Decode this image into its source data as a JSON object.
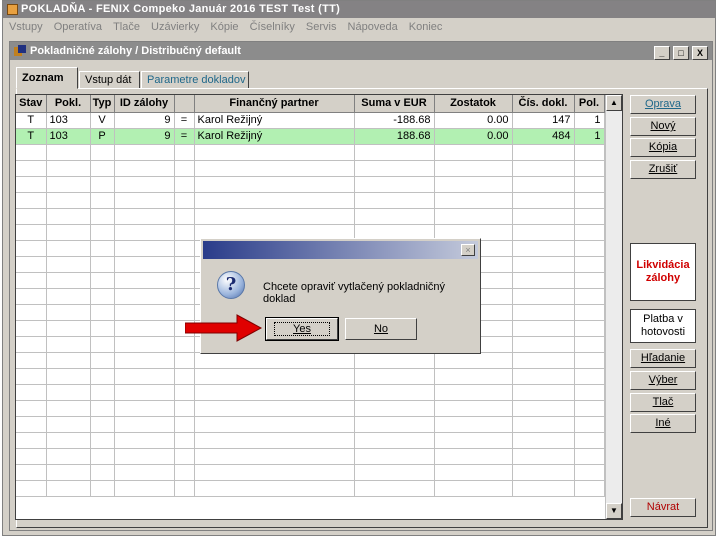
{
  "app": {
    "title": "POKLADŇA - FENIX Compeko  Január 2016  TEST Test  (TT)"
  },
  "menu": [
    "Vstupy",
    "Operatíva",
    "Tlače",
    "Uzávierky",
    "Kópie",
    "Číselníky",
    "Servis",
    "Nápoveda",
    "Koniec"
  ],
  "window": {
    "title": "Pokladničné zálohy / Distribučný default",
    "minimize": "_",
    "maximize": "□",
    "close": "X"
  },
  "tabs": [
    "Zoznam",
    "Vstup dát",
    "Parametre dokladov"
  ],
  "table": {
    "columns": [
      "Stav",
      "Pokl.",
      "Typ",
      "ID zálohy",
      "",
      "Finančný partner",
      "Suma v EUR",
      "Zostatok",
      "Čís. dokl.",
      "Pol."
    ],
    "rows": [
      [
        "T",
        "103",
        "V",
        "9",
        "=",
        "Karol Režijný",
        "-188.68",
        "0.00",
        "147",
        "1"
      ],
      [
        "T",
        "103",
        "P",
        "9",
        "=",
        "Karol Režijný",
        "188.68",
        "0.00",
        "484",
        "1"
      ]
    ],
    "selected_row": 1
  },
  "side_buttons": {
    "oprava": "Oprava",
    "novy": "Nový",
    "kopia": "Kópia",
    "zrusit": "Zrušiť",
    "likvidacia_line1": "Likvidácia",
    "likvidacia_line2": "zálohy",
    "platba_line1": "Platba v",
    "platba_line2": "hotovosti",
    "hladanie": "Hľadanie",
    "vyber": "Výber",
    "tlac": "Tlač",
    "ine": "Iné",
    "navrat": "Návrat"
  },
  "dialog": {
    "message": "Chcete opraviť vytlačený pokladničný doklad",
    "yes": "Yes",
    "no": "No",
    "close": "×"
  },
  "colors": {
    "selected_row": "#b2f0b2",
    "accent_red": "#d00000",
    "arrow": "#e00000"
  }
}
